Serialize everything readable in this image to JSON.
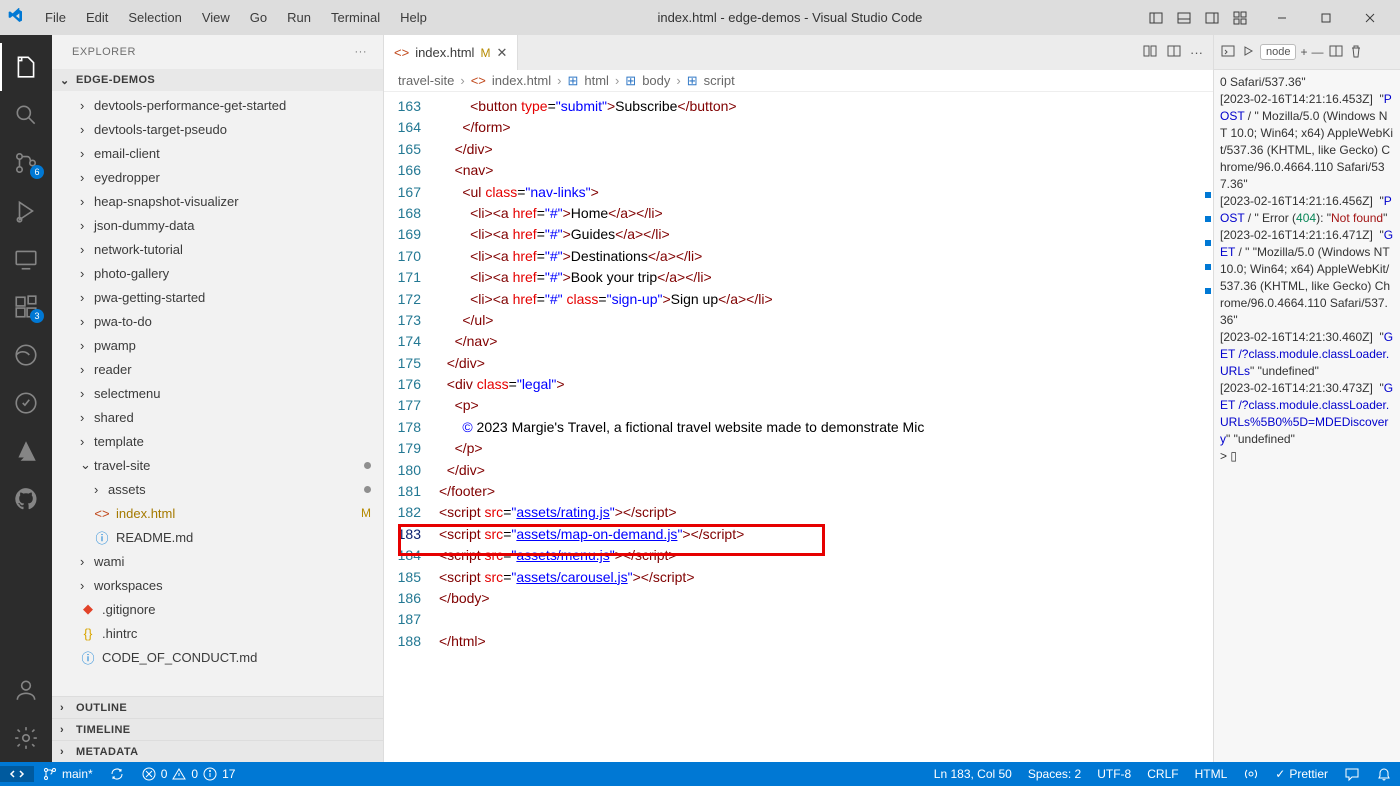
{
  "title": "index.html - edge-demos - Visual Studio Code",
  "menu": [
    "File",
    "Edit",
    "Selection",
    "View",
    "Go",
    "Run",
    "Terminal",
    "Help"
  ],
  "activity_badges": {
    "scm": "6",
    "ext": "3"
  },
  "sidebar": {
    "title": "EXPLORER",
    "root": "EDGE-DEMOS",
    "items": [
      {
        "label": "devtools-performance-get-started",
        "type": "folder",
        "lvl": 1
      },
      {
        "label": "devtools-target-pseudo",
        "type": "folder",
        "lvl": 1
      },
      {
        "label": "email-client",
        "type": "folder",
        "lvl": 1
      },
      {
        "label": "eyedropper",
        "type": "folder",
        "lvl": 1
      },
      {
        "label": "heap-snapshot-visualizer",
        "type": "folder",
        "lvl": 1
      },
      {
        "label": "json-dummy-data",
        "type": "folder",
        "lvl": 1
      },
      {
        "label": "network-tutorial",
        "type": "folder",
        "lvl": 1
      },
      {
        "label": "photo-gallery",
        "type": "folder",
        "lvl": 1
      },
      {
        "label": "pwa-getting-started",
        "type": "folder",
        "lvl": 1
      },
      {
        "label": "pwa-to-do",
        "type": "folder",
        "lvl": 1
      },
      {
        "label": "pwamp",
        "type": "folder",
        "lvl": 1
      },
      {
        "label": "reader",
        "type": "folder",
        "lvl": 1
      },
      {
        "label": "selectmenu",
        "type": "folder",
        "lvl": 1
      },
      {
        "label": "shared",
        "type": "folder",
        "lvl": 1
      },
      {
        "label": "template",
        "type": "folder",
        "lvl": 1
      },
      {
        "label": "travel-site",
        "type": "folder",
        "lvl": 1,
        "open": true,
        "dot": true
      },
      {
        "label": "assets",
        "type": "folder",
        "lvl": 2,
        "dot": true
      },
      {
        "label": "index.html",
        "type": "html",
        "lvl": 2,
        "mod": true
      },
      {
        "label": "README.md",
        "type": "md",
        "lvl": 2
      },
      {
        "label": "wami",
        "type": "folder",
        "lvl": 1
      },
      {
        "label": "workspaces",
        "type": "folder",
        "lvl": 1
      },
      {
        "label": ".gitignore",
        "type": "git",
        "lvl": 1
      },
      {
        "label": ".hintrc",
        "type": "json",
        "lvl": 1
      },
      {
        "label": "CODE_OF_CONDUCT.md",
        "type": "md",
        "lvl": 1
      }
    ],
    "sections": [
      "OUTLINE",
      "TIMELINE",
      "METADATA"
    ]
  },
  "tab": {
    "name": "index.html",
    "m": "M"
  },
  "breadcrumb": [
    "travel-site",
    "index.html",
    "html",
    "body",
    "script"
  ],
  "gutter": [
    "163",
    "164",
    "165",
    "166",
    "167",
    "168",
    "169",
    "170",
    "171",
    "172",
    "173",
    "174",
    "175",
    "176",
    "177",
    "178",
    "179",
    "180",
    "181",
    "182",
    "183",
    "184",
    "185",
    "186",
    "187",
    "188"
  ],
  "code_labels": {
    "submit": "submit",
    "subscribe": "Subscribe",
    "navlinks": "nav-links",
    "home": "Home",
    "guides": "Guides",
    "dest": "Destinations",
    "book": "Book your trip",
    "sign": "Sign up",
    "signup": "sign-up",
    "legal": "legal",
    "copy": "&copy;",
    "copytxt": " 2023 Margie's Travel, a fictional travel website made to demonstrate Mic",
    "rating": "assets/rating.js",
    "map": "assets/map-on-demand.js",
    "menu": "assets/menu.js",
    "carousel": "assets/carousel.js"
  },
  "debug": {
    "node": "node",
    "out": "0 Safari/537.36\"\n[2023-02-16T14:21:16.453Z]  \"POST / \" Mozilla/5.0 (Windows NT 10.0; Win64; x64) AppleWebKit/537.36 (KHTML, like Gecko) Chrome/96.0.4664.110 Safari/537.36\"\n[2023-02-16T14:21:16.456Z]  \"POST / \" Error (404): \"Not found\"\n[2023-02-16T14:21:16.471Z]  \"GET / \" \"Mozilla/5.0 (Windows NT 10.0; Win64; x64) AppleWebKit/537.36 (KHTML, like Gecko) Chrome/96.0.4664.110 Safari/537.36\"\n[2023-02-16T14:21:30.460Z]  \"GET /?class.module.classLoader.URLs\" \"undefined\"\n[2023-02-16T14:21:30.473Z]  \"GET /?class.module.classLoader.URLs%5B0%5D=MDEDiscovery\" \"undefined\"\n> ▯"
  },
  "status": {
    "branch": "main*",
    "errors": "0",
    "warnings": "0",
    "info": "17",
    "pos": "Ln 183, Col 50",
    "spaces": "Spaces: 2",
    "enc": "UTF-8",
    "eol": "CRLF",
    "lang": "HTML",
    "prettier": "Prettier"
  }
}
